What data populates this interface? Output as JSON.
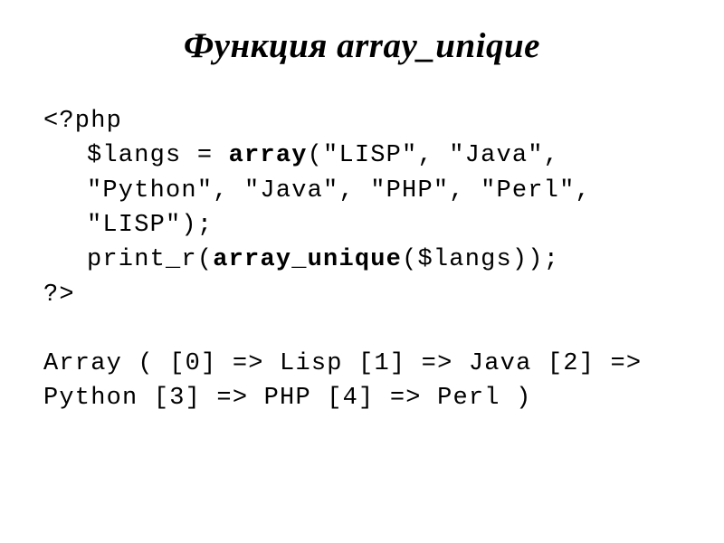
{
  "title": "Функция array_unique",
  "code": {
    "line1": "<?php",
    "line2_part1": "$langs = ",
    "line2_part2": "array",
    "line2_part3": "(\"LISP\", \"Java\", \"Python\", \"Java\", \"PHP\", \"Perl\", \"LISP\");",
    "line3_part1": "print_r(",
    "line3_part2": "array_unique",
    "line3_part3": "($langs));",
    "line4": "?>",
    "output": "Array ( [0] => Lisp [1] => Java [2] => Python [3] => PHP [4] => Perl )"
  }
}
